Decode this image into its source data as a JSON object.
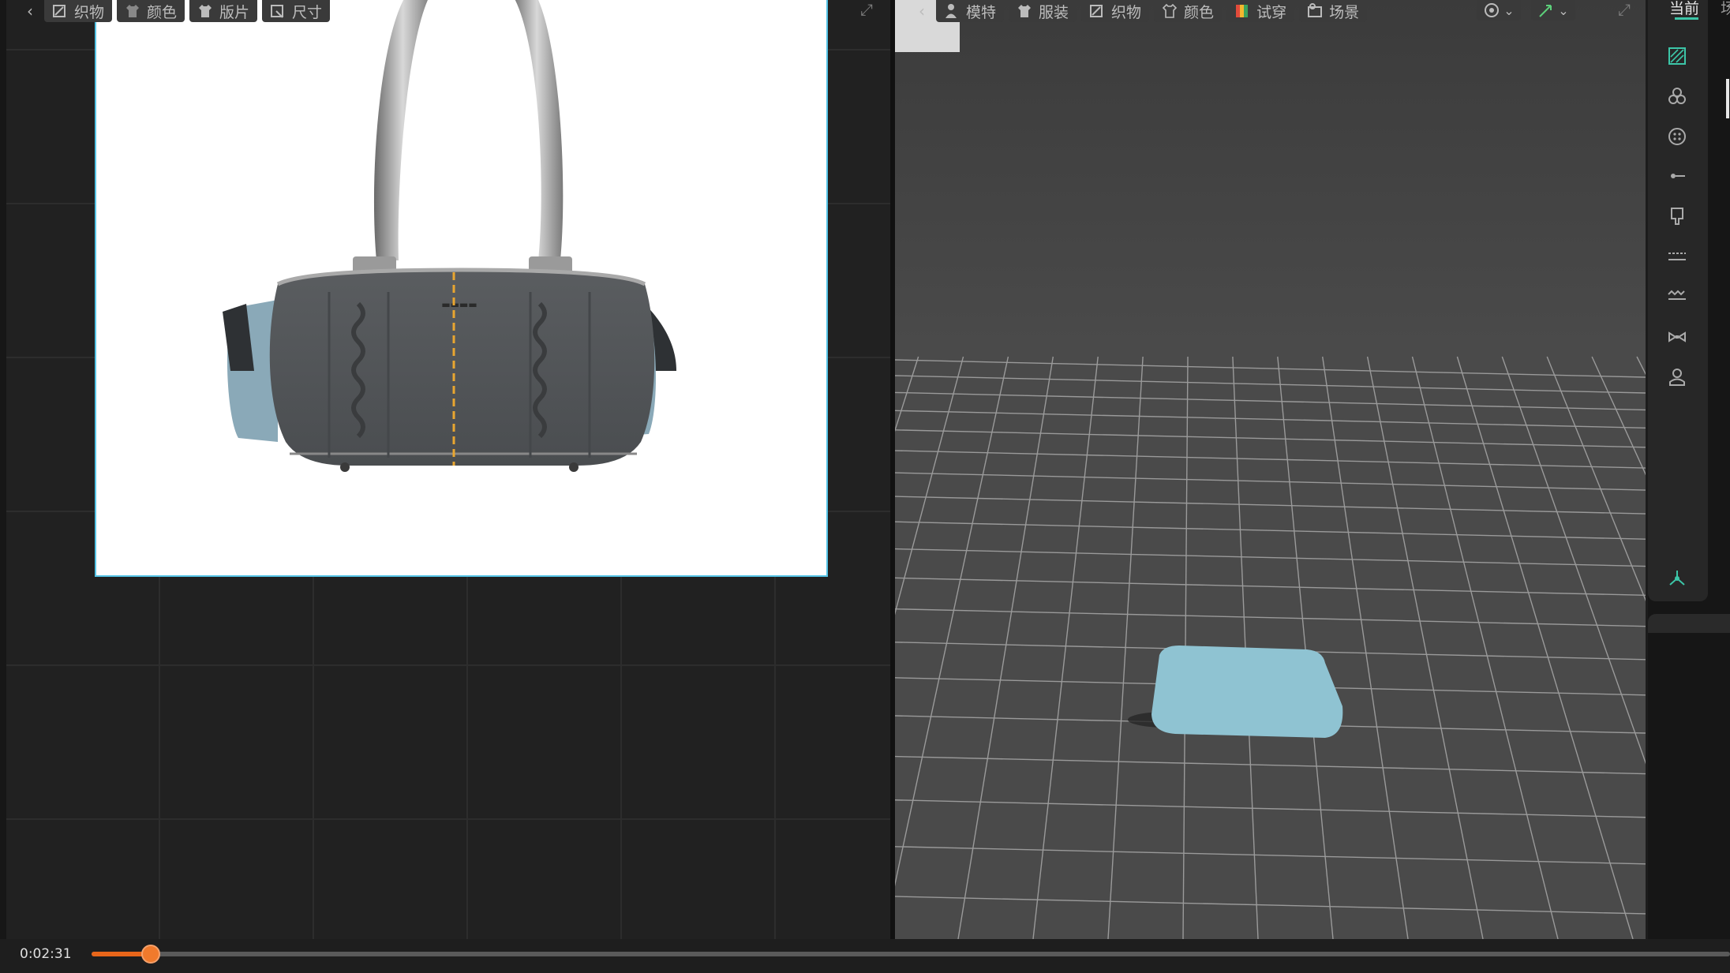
{
  "left_toolbar": {
    "back_glyph": "‹",
    "buttons": [
      {
        "label": "织物",
        "icon": "fabric-icon"
      },
      {
        "label": "颜色",
        "icon": "color-shirt-icon"
      },
      {
        "label": "版片",
        "icon": "pattern-piece-icon"
      },
      {
        "label": "尺寸",
        "icon": "size-icon"
      }
    ],
    "expand_glyph": "⤢"
  },
  "right_toolbar": {
    "back_glyph": "‹",
    "buttons": [
      {
        "label": "模特",
        "icon": "avatar-icon"
      },
      {
        "label": "服装",
        "icon": "garment-icon"
      },
      {
        "label": "织物",
        "icon": "fabric-icon"
      },
      {
        "label": "颜色",
        "icon": "color-shirt-icon"
      },
      {
        "label": "试穿",
        "icon": "try-on-icon"
      },
      {
        "label": "场景",
        "icon": "scene-icon"
      }
    ],
    "view_dropdown_icon": "render-mode-icon",
    "tool_dropdown_icon": "transform-tool-icon",
    "expand_glyph": "⤢"
  },
  "sidebar": {
    "tab_current": "当前",
    "tab_scene": "场",
    "icons": [
      "fabric-swatch-icon",
      "button-icon",
      "snap-button-icon",
      "zipper-pull-icon",
      "tag-icon",
      "stitch-line-icon",
      "zigzag-stitch-icon",
      "bow-icon",
      "avatar-person-icon"
    ],
    "bottom_icon": "axis-gizmo-icon"
  },
  "playback": {
    "time": "0:02:31",
    "progress": 0.036
  },
  "colors": {
    "accent_orange": "#e8661a",
    "ref_border": "#55c4e6",
    "garment_piece": "#8fc3d2",
    "tab_underline": "#3cc6a8"
  }
}
